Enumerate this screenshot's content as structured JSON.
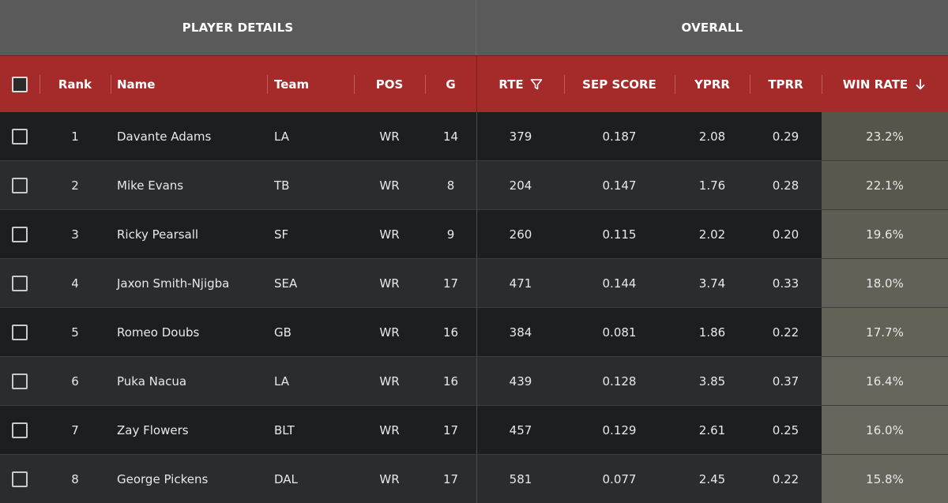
{
  "groups": {
    "player_details": "PLAYER DETAILS",
    "overall": "OVERALL"
  },
  "columns": {
    "rank": "Rank",
    "name": "Name",
    "team": "Team",
    "pos": "POS",
    "g": "G",
    "rte": "RTE",
    "sep_score": "SEP SCORE",
    "yprr": "YPRR",
    "tprr": "TPRR",
    "win_rate": "WIN RATE"
  },
  "icons": {
    "rte": "filter-icon",
    "win_rate": "sort-descending-arrow-icon"
  },
  "colors": {
    "group_header_bg": "#5a5a5a",
    "column_header_bg": "#a52a2a",
    "row_dark": "#1c1f20",
    "row_light": "#2a2d2e",
    "win_rate_highlight_start": "#55554a",
    "win_rate_highlight_end": "#66665c"
  },
  "rows": [
    {
      "rank": "1",
      "name": "Davante Adams",
      "team": "LA",
      "pos": "WR",
      "g": "14",
      "rte": "379",
      "sep_score": "0.187",
      "yprr": "2.08",
      "tprr": "0.29",
      "win_rate": "23.2%",
      "win_rate_value": 23.2
    },
    {
      "rank": "2",
      "name": "Mike Evans",
      "team": "TB",
      "pos": "WR",
      "g": "8",
      "rte": "204",
      "sep_score": "0.147",
      "yprr": "1.76",
      "tprr": "0.28",
      "win_rate": "22.1%",
      "win_rate_value": 22.1
    },
    {
      "rank": "3",
      "name": "Ricky Pearsall",
      "team": "SF",
      "pos": "WR",
      "g": "9",
      "rte": "260",
      "sep_score": "0.115",
      "yprr": "2.02",
      "tprr": "0.20",
      "win_rate": "19.6%",
      "win_rate_value": 19.6
    },
    {
      "rank": "4",
      "name": "Jaxon Smith-Njigba",
      "team": "SEA",
      "pos": "WR",
      "g": "17",
      "rte": "471",
      "sep_score": "0.144",
      "yprr": "3.74",
      "tprr": "0.33",
      "win_rate": "18.0%",
      "win_rate_value": 18.0
    },
    {
      "rank": "5",
      "name": "Romeo Doubs",
      "team": "GB",
      "pos": "WR",
      "g": "16",
      "rte": "384",
      "sep_score": "0.081",
      "yprr": "1.86",
      "tprr": "0.22",
      "win_rate": "17.7%",
      "win_rate_value": 17.7
    },
    {
      "rank": "6",
      "name": "Puka Nacua",
      "team": "LA",
      "pos": "WR",
      "g": "16",
      "rte": "439",
      "sep_score": "0.128",
      "yprr": "3.85",
      "tprr": "0.37",
      "win_rate": "16.4%",
      "win_rate_value": 16.4
    },
    {
      "rank": "7",
      "name": "Zay Flowers",
      "team": "BLT",
      "pos": "WR",
      "g": "17",
      "rte": "457",
      "sep_score": "0.129",
      "yprr": "2.61",
      "tprr": "0.25",
      "win_rate": "16.0%",
      "win_rate_value": 16.0
    },
    {
      "rank": "8",
      "name": "George Pickens",
      "team": "DAL",
      "pos": "WR",
      "g": "17",
      "rte": "581",
      "sep_score": "0.077",
      "yprr": "2.45",
      "tprr": "0.22",
      "win_rate": "15.8%",
      "win_rate_value": 15.8
    }
  ]
}
